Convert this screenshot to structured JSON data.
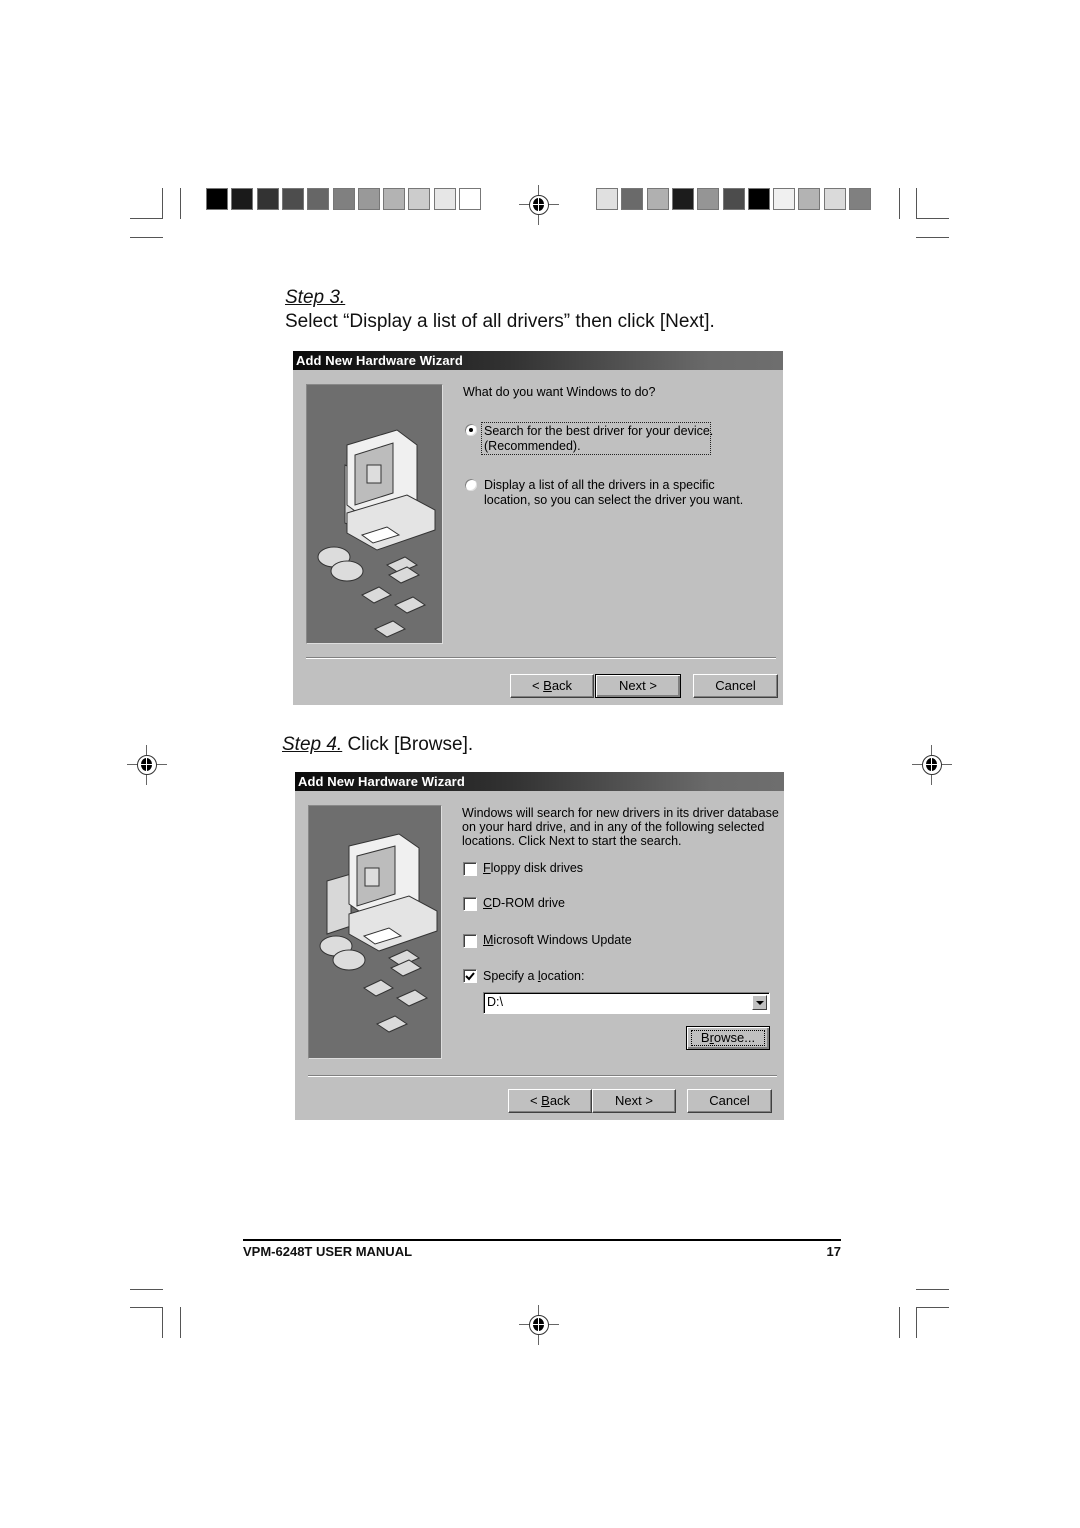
{
  "color_bars": {
    "left": [
      "#000000",
      "#1a1a1a",
      "#333333",
      "#4d4d4d",
      "#666666",
      "#808080",
      "#999999",
      "#b3b3b3",
      "#cccccc",
      "#e6e6e6",
      "#ffffff"
    ],
    "right": [
      "#e0e0e0",
      "#6a6a6a",
      "#b0b0b0",
      "#1c1c1c",
      "#959595",
      "#4c4c4c",
      "#000000",
      "#f0f0f0",
      "#b3b3b3",
      "#dadada",
      "#808080"
    ]
  },
  "step3": {
    "label": "Step 3.",
    "instruction": "Select “Display a list of all drivers” then click [Next].",
    "dialog": {
      "title": "Add New Hardware Wizard",
      "prompt": "What do you want Windows to do?",
      "options": [
        {
          "line1": "Search for the best driver for your device.",
          "line2": "(Recommended).",
          "selected": true
        },
        {
          "line1": "Display a list of all the drivers in a specific",
          "line2": "location, so you can select the driver you want.",
          "selected": false
        }
      ],
      "buttons": {
        "back": "< Back",
        "back_accel": "B",
        "next": "Next >",
        "cancel": "Cancel"
      }
    }
  },
  "step4": {
    "label": "Step 4.",
    "instruction": "Click [Browse].",
    "dialog": {
      "title": "Add New Hardware Wizard",
      "description": [
        "Windows will search for new drivers in its driver database",
        "on your hard drive, and in any of the following selected",
        "locations. Click Next to start the search."
      ],
      "checkboxes": [
        {
          "label": "Floppy disk drives",
          "accel": "F",
          "checked": false
        },
        {
          "label": "CD-ROM drive",
          "accel": "C",
          "checked": false
        },
        {
          "label": "Microsoft Windows Update",
          "accel": "M",
          "checked": false
        },
        {
          "label": "Specify a location:",
          "accel": "l",
          "checked": true
        }
      ],
      "location_value": "D:\\",
      "browse_label": "Browse...",
      "buttons": {
        "back": "< Back",
        "next": "Next >",
        "cancel": "Cancel"
      }
    }
  },
  "footer": {
    "title": "VPM-6248T USER MANUAL",
    "page_number": "17"
  }
}
